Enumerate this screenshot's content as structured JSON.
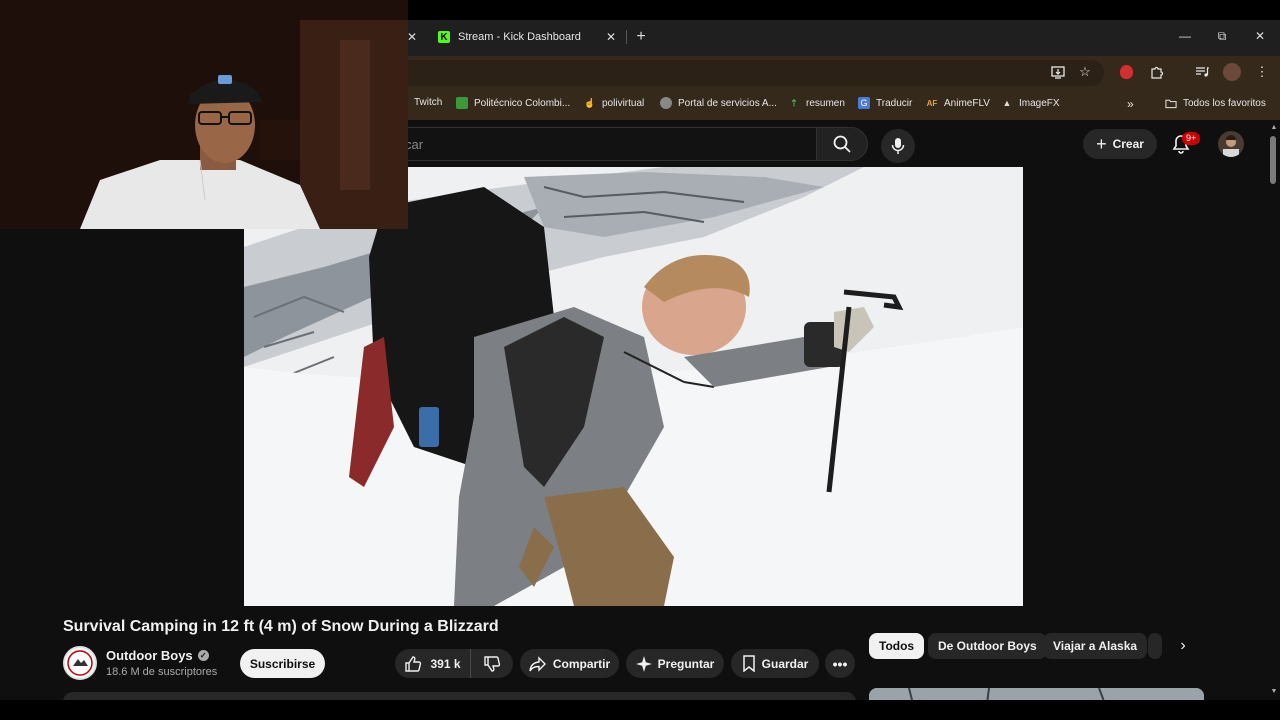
{
  "browser": {
    "tabs": [
      {
        "label": "Stream - Kick Dashboard",
        "favicon": "kick-icon",
        "active": true
      }
    ],
    "new_tab_symbol": "+",
    "bookmarks": [
      {
        "label": "Twitch",
        "icon": "twitch-icon"
      },
      {
        "label": "Politécnico Colombi...",
        "icon": "politecnico-icon"
      },
      {
        "label": "polivirtual",
        "icon": "polivirtual-icon"
      },
      {
        "label": "Portal de servicios A...",
        "icon": "globe-icon"
      },
      {
        "label": "resumen",
        "icon": "resumen-icon"
      },
      {
        "label": "Traducir",
        "icon": "translate-icon"
      },
      {
        "label": "AnimeFLV",
        "icon": "animeflv-icon"
      },
      {
        "label": "ImageFX",
        "icon": "imagefx-icon"
      }
    ],
    "bookmarks_overflow": "»",
    "all_bookmarks": "Todos los favoritos"
  },
  "youtube": {
    "search_placeholder": "car",
    "create_label": "Crear",
    "notification_badge": "9+"
  },
  "video": {
    "title": "Survival Camping in 12 ft (4 m) of Snow During a Blizzard",
    "channel_name": "Outdoor Boys",
    "subscribers": "18.6 M de suscriptores",
    "subscribe_label": "Suscribirse",
    "likes": "391 k",
    "share_label": "Compartir",
    "ask_label": "Preguntar",
    "save_label": "Guardar"
  },
  "chips": [
    {
      "label": "Todos",
      "active": true
    },
    {
      "label": "De Outdoor Boys",
      "active": false
    },
    {
      "label": "Viajar a Alaska",
      "active": false
    }
  ],
  "colors": {
    "kick_green": "#53fc18",
    "yt_red_badge": "#cc0000",
    "address_bar_brown": "#35291b"
  }
}
